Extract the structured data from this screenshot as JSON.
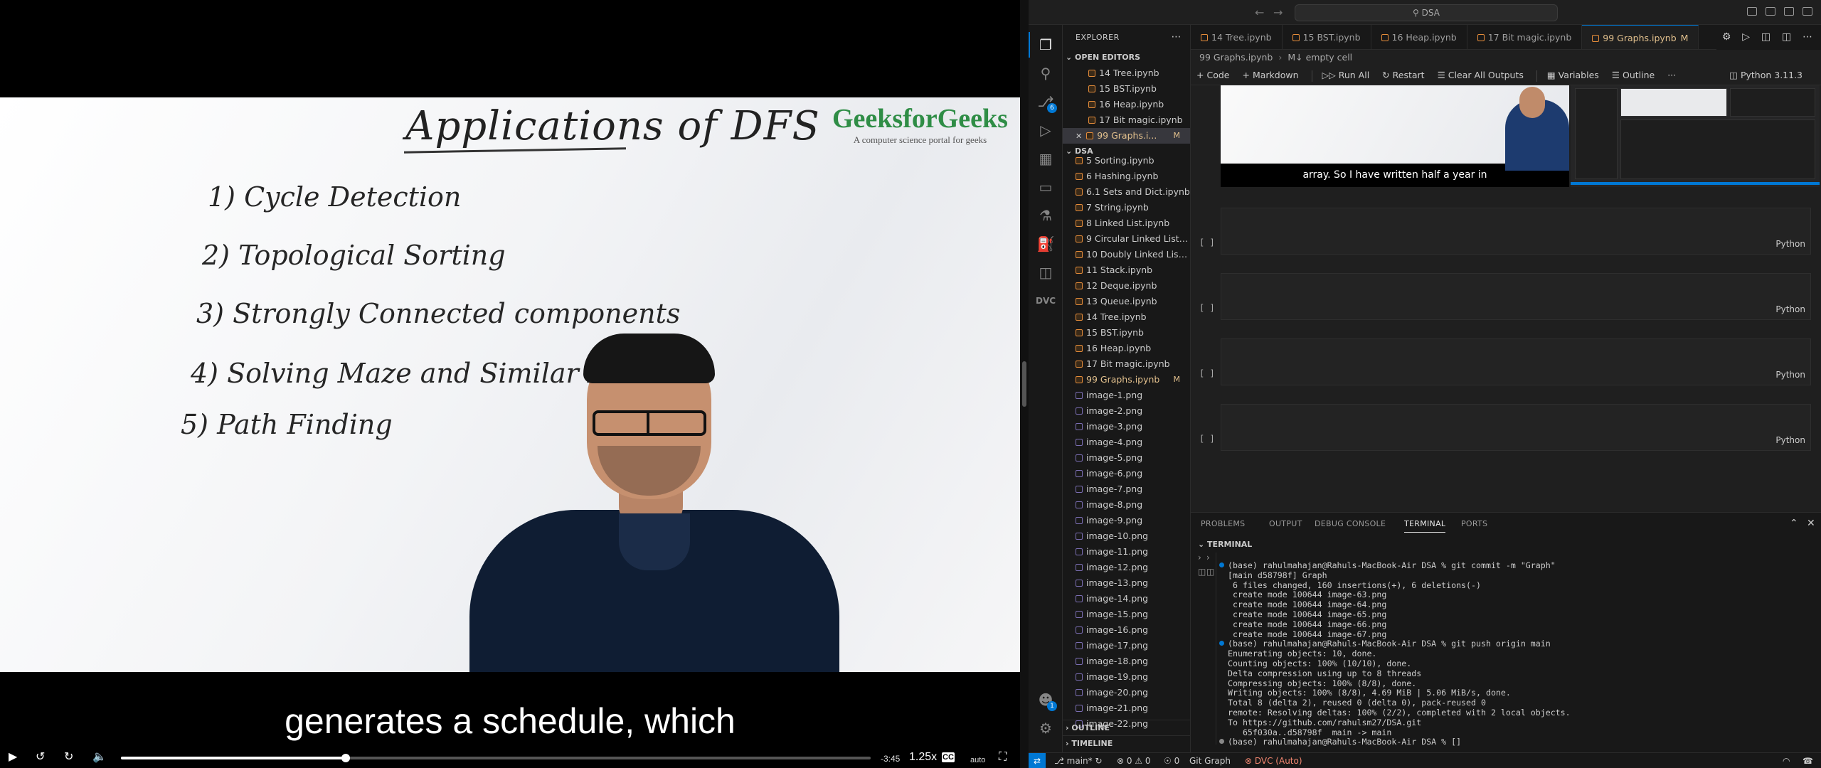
{
  "video": {
    "whiteboard_title": "Applications of DFS",
    "whiteboard_items": [
      "1) Cycle Detection",
      "2) Topological Sorting",
      "3) Strongly Connected components",
      "4) Solving Maze and Similar Puzzles",
      "5) Path Finding"
    ],
    "brand_name": "GeeksforGeeks",
    "brand_tagline": "A computer science portal for geeks",
    "subtitle": "generates a schedule, which",
    "time_remaining": "-3:45",
    "speed": "1.25x",
    "cc_label": "CC",
    "quality": "auto",
    "progress": 0.3
  },
  "vscode": {
    "search_text": "DSA",
    "explorer_label": "EXPLORER",
    "open_editors_label": "OPEN EDITORS",
    "open_editors": [
      {
        "name": "14 Tree.ipynb",
        "active": false
      },
      {
        "name": "15 BST.ipynb",
        "active": false
      },
      {
        "name": "16 Heap.ipynb",
        "active": false
      },
      {
        "name": "17 Bit magic.ipynb",
        "active": false
      },
      {
        "name": "99 Graphs.i...",
        "active": true,
        "badge": "M"
      }
    ],
    "folder_label": "DSA",
    "files": [
      {
        "name": "5 Sorting.ipynb",
        "type": "nb"
      },
      {
        "name": "6 Hashing.ipynb",
        "type": "nb"
      },
      {
        "name": "6.1 Sets and Dict.ipynb",
        "type": "nb"
      },
      {
        "name": "7 String.ipynb",
        "type": "nb"
      },
      {
        "name": "8 Linked List.ipynb",
        "type": "nb"
      },
      {
        "name": "9 Circular Linked List....",
        "type": "nb"
      },
      {
        "name": "10 Doubly Linked List....",
        "type": "nb"
      },
      {
        "name": "11 Stack.ipynb",
        "type": "nb"
      },
      {
        "name": "12 Deque.ipynb",
        "type": "nb"
      },
      {
        "name": "13 Queue.ipynb",
        "type": "nb"
      },
      {
        "name": "14 Tree.ipynb",
        "type": "nb"
      },
      {
        "name": "15 BST.ipynb",
        "type": "nb"
      },
      {
        "name": "16 Heap.ipynb",
        "type": "nb"
      },
      {
        "name": "17 Bit magic.ipynb",
        "type": "nb"
      },
      {
        "name": "99 Graphs.ipynb",
        "type": "nb",
        "modified": true,
        "badge": "M"
      },
      {
        "name": "image-1.png",
        "type": "img"
      },
      {
        "name": "image-2.png",
        "type": "img"
      },
      {
        "name": "image-3.png",
        "type": "img"
      },
      {
        "name": "image-4.png",
        "type": "img"
      },
      {
        "name": "image-5.png",
        "type": "img"
      },
      {
        "name": "image-6.png",
        "type": "img"
      },
      {
        "name": "image-7.png",
        "type": "img"
      },
      {
        "name": "image-8.png",
        "type": "img"
      },
      {
        "name": "image-9.png",
        "type": "img"
      },
      {
        "name": "image-10.png",
        "type": "img"
      },
      {
        "name": "image-11.png",
        "type": "img"
      },
      {
        "name": "image-12.png",
        "type": "img"
      },
      {
        "name": "image-13.png",
        "type": "img"
      },
      {
        "name": "image-14.png",
        "type": "img"
      },
      {
        "name": "image-15.png",
        "type": "img"
      },
      {
        "name": "image-16.png",
        "type": "img"
      },
      {
        "name": "image-17.png",
        "type": "img"
      },
      {
        "name": "image-18.png",
        "type": "img"
      },
      {
        "name": "image-19.png",
        "type": "img"
      },
      {
        "name": "image-20.png",
        "type": "img"
      },
      {
        "name": "image-21.png",
        "type": "img"
      },
      {
        "name": "image-22.png",
        "type": "img"
      }
    ],
    "outline_label": "OUTLINE",
    "timeline_label": "TIMELINE",
    "tabs": [
      {
        "name": "14 Tree.ipynb",
        "active": false
      },
      {
        "name": "15 BST.ipynb",
        "active": false
      },
      {
        "name": "16 Heap.ipynb",
        "active": false
      },
      {
        "name": "17 Bit magic.ipynb",
        "active": false
      },
      {
        "name": "99 Graphs.ipynb",
        "active": true,
        "badge": "M"
      }
    ],
    "breadcrumb": [
      "99 Graphs.ipynb",
      "M↓ empty cell"
    ],
    "toolbar": {
      "code": "Code",
      "markdown": "Markdown",
      "run_all": "Run All",
      "restart": "Restart",
      "clear_outputs": "Clear All Outputs",
      "variables": "Variables",
      "outline": "Outline",
      "more": "···",
      "kernel": "Python 3.11.3"
    },
    "output_subtitle": "array. So I have written half a year in",
    "cells": [
      {
        "bracket": "[ ]",
        "lang": "Python"
      },
      {
        "bracket": "[ ]",
        "lang": "Python"
      },
      {
        "bracket": "[ ]",
        "lang": "Python"
      },
      {
        "bracket": "[ ]",
        "lang": "Python"
      }
    ],
    "panel_tabs": [
      "PROBLEMS",
      "OUTPUT",
      "DEBUG CONSOLE",
      "TERMINAL",
      "PORTS"
    ],
    "active_panel_tab": "TERMINAL",
    "terminal_label": "TERMINAL",
    "terminal_lines": [
      {
        "dot": "blue",
        "text": "(base) rahulmahajan@Rahuls-MacBook-Air DSA % git commit -m \"Graph\""
      },
      {
        "text": "[main d58798f] Graph"
      },
      {
        "text": " 6 files changed, 160 insertions(+), 6 deletions(-)"
      },
      {
        "text": " create mode 100644 image-63.png"
      },
      {
        "text": " create mode 100644 image-64.png"
      },
      {
        "text": " create mode 100644 image-65.png"
      },
      {
        "text": " create mode 100644 image-66.png"
      },
      {
        "text": " create mode 100644 image-67.png"
      },
      {
        "dot": "blue",
        "text": "(base) rahulmahajan@Rahuls-MacBook-Air DSA % git push origin main"
      },
      {
        "text": "Enumerating objects: 10, done."
      },
      {
        "text": "Counting objects: 100% (10/10), done."
      },
      {
        "text": "Delta compression using up to 8 threads"
      },
      {
        "text": "Compressing objects: 100% (8/8), done."
      },
      {
        "text": "Writing objects: 100% (8/8), 4.69 MiB | 5.06 MiB/s, done."
      },
      {
        "text": "Total 8 (delta 2), reused 0 (delta 0), pack-reused 0"
      },
      {
        "text": "remote: Resolving deltas: 100% (2/2), completed with 2 local objects."
      },
      {
        "text": "To https://github.com/rahulsm27/DSA.git"
      },
      {
        "text": "   65f030a..d58798f  main -> main"
      },
      {
        "dot": "grey",
        "text": "(base) rahulmahajan@Rahuls-MacBook-Air DSA % []"
      }
    ],
    "status": {
      "branch": "main*",
      "errors": "0",
      "warnings": "0",
      "ports": "0",
      "git_graph": "Git Graph",
      "dvc": "DVC (Auto)"
    },
    "badges": {
      "source_control": "6",
      "accounts": "1"
    },
    "colors": {
      "accent": "#0078d4",
      "modified": "#e2c08d",
      "gfg_green": "#2f8d46",
      "dvc": "#f48771"
    }
  }
}
